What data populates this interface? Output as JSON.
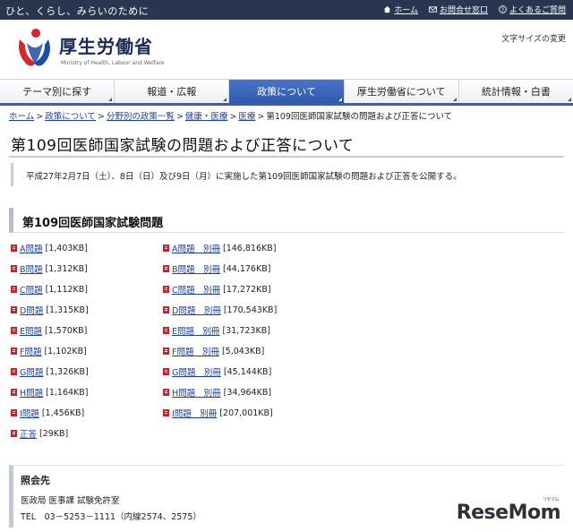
{
  "topbar": {
    "tagline": "ひと、くらし、みらいのために",
    "links": [
      {
        "label": "ホーム",
        "icon": "home-icon"
      },
      {
        "label": "お問合せ窓口",
        "icon": "mail-icon"
      },
      {
        "label": "よくあるご質問",
        "icon": "faq-icon"
      }
    ]
  },
  "header": {
    "logo_title": "厚生労働省",
    "logo_subtitle": "Ministry of Health, Labour and Welfare",
    "font_size_label": "文字サイズの変更"
  },
  "nav": {
    "items": [
      {
        "label": "テーマ別に探す",
        "active": false
      },
      {
        "label": "報道・広報",
        "active": false
      },
      {
        "label": "政策について",
        "active": true
      },
      {
        "label": "厚生労働省について",
        "active": false
      },
      {
        "label": "統計情報・白書",
        "active": false
      }
    ]
  },
  "breadcrumb": {
    "items": [
      "ホーム",
      "政策について",
      "分野別の政策一覧",
      "健康・医療",
      "医療"
    ],
    "current": "第109回医師国家試験の問題および正答について",
    "separator": ">"
  },
  "page": {
    "title": "第109回医師国家試験の問題および正答について",
    "intro": "平成27年2月7日（土）、8日（日）及び9日（月）に実施した第109回医師国家試験の問題および正答を公開する。"
  },
  "section": {
    "heading": "第109回医師国家試験問題",
    "left_docs": [
      {
        "label": "A問題",
        "size": "[1,403KB]"
      },
      {
        "label": "B問題",
        "size": "[1,312KB]"
      },
      {
        "label": "C問題",
        "size": "[1,112KB]"
      },
      {
        "label": "D問題",
        "size": "[1,315KB]"
      },
      {
        "label": "E問題",
        "size": "[1,570KB]"
      },
      {
        "label": "F問題",
        "size": "[1,102KB]"
      },
      {
        "label": "G問題",
        "size": "[1,326KB]"
      },
      {
        "label": "H問題",
        "size": "[1,164KB]"
      },
      {
        "label": "I問題",
        "size": "[1,456KB]"
      },
      {
        "label": "正答",
        "size": "[29KB]"
      }
    ],
    "right_docs": [
      {
        "label": "A問題　別冊",
        "size": "[146,816KB]"
      },
      {
        "label": "B問題　別冊",
        "size": "[44,176KB]"
      },
      {
        "label": "C問題　別冊",
        "size": "[17,272KB]"
      },
      {
        "label": "D問題　別冊",
        "size": "[170,543KB]"
      },
      {
        "label": "E問題　別冊",
        "size": "[31,723KB]"
      },
      {
        "label": "F問題　別冊",
        "size": "[5,043KB]"
      },
      {
        "label": "G問題　別冊",
        "size": "[45,144KB]"
      },
      {
        "label": "H問題　別冊",
        "size": "[34,964KB]"
      },
      {
        "label": "I問題　別冊",
        "size": "[207,001KB]"
      }
    ]
  },
  "contact": {
    "heading": "照会先",
    "line1": "医政局 医事課 試験免許室",
    "line2": "TEL　03－5253－1111（内線2574、2575）"
  },
  "watermark": {
    "text": "ReseMom",
    "small": "リセマム"
  },
  "colors": {
    "topbar": "#2a3550",
    "nav_active": "#3460b8",
    "link": "#1a3fa8",
    "pdf": "#c8242a"
  }
}
